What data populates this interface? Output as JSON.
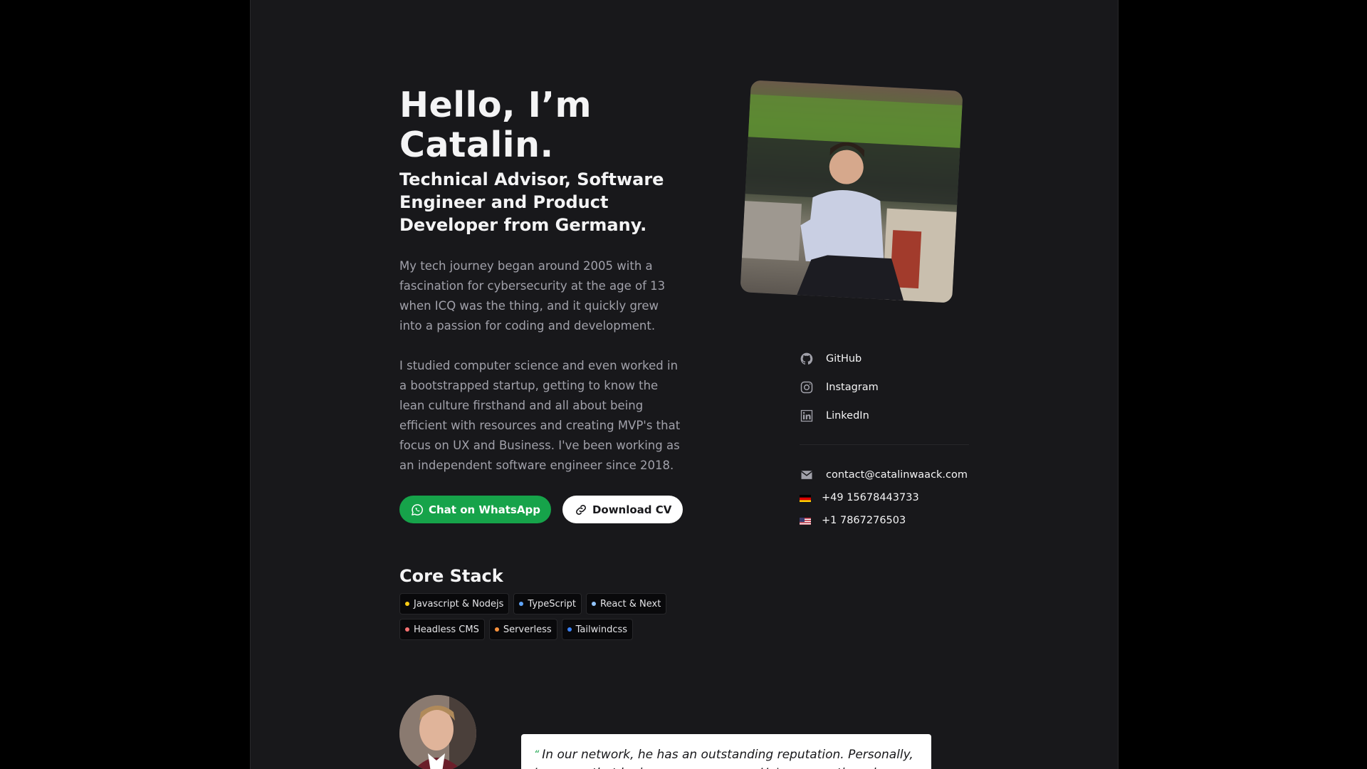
{
  "hero": {
    "greeting": "Hello, I’m Catalin.",
    "subtitle": "Technical Advisor, Software Engineer and Product Developer from Germany.",
    "paragraphs": [
      "My tech journey began around 2005 with a fascination for cybersecurity at the age of 13 when ICQ was the thing, and it quickly grew into a passion for coding and development.",
      "I studied computer science and even worked in a bootstrapped startup, getting to know the lean culture firsthand and all about being efficient with resources and creating MVP's that focus on UX and Business. I've been working as an independent software engineer since 2018."
    ]
  },
  "buttons": {
    "whatsapp": "Chat on WhatsApp",
    "download_cv": "Download CV"
  },
  "core_stack": {
    "title": "Core Stack",
    "tags": [
      {
        "label": "Javascript & Nodejs",
        "color": "#facc15"
      },
      {
        "label": "TypeScript",
        "color": "#60a5fa"
      },
      {
        "label": "React & Next",
        "color": "#93c5fd"
      },
      {
        "label": "Headless CMS",
        "color": "#f87171"
      },
      {
        "label": "Serverless",
        "color": "#fb923c"
      },
      {
        "label": "Tailwindcss",
        "color": "#3b82f6"
      }
    ]
  },
  "social": [
    {
      "label": "GitHub",
      "icon": "github-icon"
    },
    {
      "label": "Instagram",
      "icon": "instagram-icon"
    },
    {
      "label": "LinkedIn",
      "icon": "linkedin-icon"
    }
  ],
  "contact": {
    "email": "contact@catalinwaack.com",
    "phone_de": "+49 15678443733",
    "phone_us": "+1 7867276503"
  },
  "testimonial": {
    "quote_mark": "“",
    "text": "In our network, he has an outstanding reputation. Personally, I can say that he is a one-man army. He's pragmatic, solves"
  },
  "colors": {
    "page_bg": "#18181b",
    "outer_bg": "#000000",
    "accent_green": "#16a34a"
  }
}
